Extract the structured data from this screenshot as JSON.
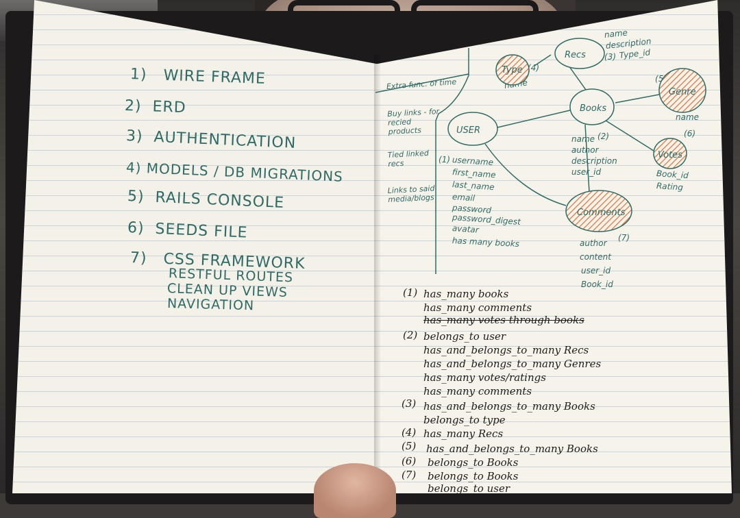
{
  "todo_list": [
    {
      "num": "1)",
      "text": "WIRE FRAME"
    },
    {
      "num": "2)",
      "text": "ERD"
    },
    {
      "num": "3)",
      "text": "AUTHENTICATION"
    },
    {
      "num": "4)",
      "text": "MODELS / DB MIGRATIONS"
    },
    {
      "num": "5)",
      "text": "RAILS CONSOLE"
    },
    {
      "num": "6)",
      "text": "SEEDS FILE"
    },
    {
      "num": "7)",
      "text": "CSS FRAMEWORK"
    }
  ],
  "todo_sub": [
    "RESTFUL ROUTES",
    "CLEAN UP VIEWS",
    "NAVIGATION"
  ],
  "side_notes": [
    "Extra func. of time",
    "Buy links - for recied products",
    "Tied linked recs",
    "Links to said media/blogs"
  ],
  "entities": {
    "user": "USER",
    "recs": "Recs",
    "type": "Type",
    "books": "Books",
    "genre": "Genre",
    "votes": "Votes",
    "comments": "Comments"
  },
  "attrs": {
    "user": [
      "username",
      "first_name",
      "last_name",
      "email",
      "password",
      "password_digest",
      "avatar",
      "has many books"
    ],
    "recs": [
      "name",
      "description",
      "Type_id"
    ],
    "type": [
      "name"
    ],
    "genre": [
      "name"
    ],
    "votes": [
      "Book_id",
      "Rating"
    ],
    "books": [
      "name",
      "author",
      "description",
      "user_id"
    ],
    "comments": [
      "author",
      "content",
      "user_id",
      "Book_id"
    ]
  },
  "markers": [
    "1",
    "2",
    "3",
    "4",
    "5",
    "6",
    "7"
  ],
  "relations": [
    {
      "num": "1",
      "lines": [
        "has_many books",
        "has_many comments",
        "has_many votes through books"
      ]
    },
    {
      "num": "2",
      "lines": [
        "belongs_to user",
        "has_and_belongs_to_many Recs",
        "has_and_belongs_to_many Genres",
        "has_many votes/ratings",
        "has_many comments"
      ]
    },
    {
      "num": "3",
      "lines": [
        "has_and_belongs_to_many Books",
        "belongs_to type"
      ]
    },
    {
      "num": "4",
      "lines": [
        "has_many Recs"
      ]
    },
    {
      "num": "5",
      "lines": [
        "has_and_belongs_to_many Books"
      ]
    },
    {
      "num": "6",
      "lines": [
        "belongs_to Books"
      ]
    },
    {
      "num": "7",
      "lines": [
        "belongs_to Books",
        "belongs_to user"
      ]
    }
  ],
  "colors": {
    "teal_ink": "#2f6b66",
    "black_ink": "#1e1c1c",
    "orange_hatch": "#e0733a",
    "paper": "#f4f1e8"
  }
}
